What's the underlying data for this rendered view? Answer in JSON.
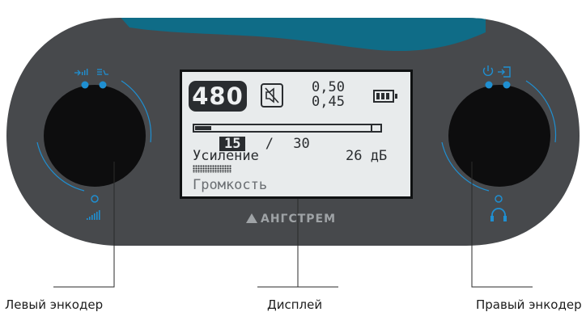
{
  "display": {
    "big_number": "480",
    "value_top": "0,50",
    "value_bottom": "0,45",
    "progress_fraction": 0.09,
    "counter_current": "15",
    "counter_separator": "/",
    "counter_total": "30",
    "gain_label": "Усиление",
    "gain_value": "26 дБ",
    "volume_label": "Громкость",
    "battery_bars": 3
  },
  "brand": {
    "name": "АНГСТРЕМ"
  },
  "icons": {
    "left_top": [
      "input-level-icon",
      "menu-list-icon"
    ],
    "left_bottom": "signal-bars-icon",
    "right_top": [
      "power-icon",
      "login-icon"
    ],
    "right_bottom": "headphones-icon"
  },
  "callouts": {
    "left": "Левый энкодер",
    "center": "Дисплей",
    "right": "Правый энкодер"
  },
  "colors": {
    "body": "#47494c",
    "accent": "#1f8fd1",
    "top_band": "#0f6c87",
    "knob": "#0d0d0e"
  }
}
